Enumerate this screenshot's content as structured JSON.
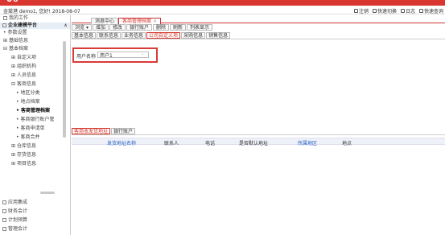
{
  "user": {
    "welcome": "金棠港 demo1, 您好! 2018-08-07"
  },
  "header_links": [
    {
      "label": "注销",
      "icon": "logout-icon"
    },
    {
      "label": "快速切换",
      "icon": "switch-icon"
    },
    {
      "label": "日志",
      "icon": "log-icon"
    },
    {
      "label": "快速查询",
      "icon": "quick-search-icon"
    }
  ],
  "sidebar": {
    "my_work": "我的工作",
    "section": "企业建模平台",
    "items": [
      {
        "label": "参数设置",
        "prefix": "•"
      },
      {
        "label": "基础信息",
        "prefix": "⊞"
      },
      {
        "label": "基本档案",
        "prefix": "⊟"
      },
      {
        "label": "自定义项",
        "prefix": "⊞"
      },
      {
        "label": "组织机构",
        "prefix": "⊞"
      },
      {
        "label": "人员信息",
        "prefix": "⊞"
      },
      {
        "label": "客商信息",
        "prefix": "⊟"
      },
      {
        "label": "地区分类",
        "prefix": "•"
      },
      {
        "label": "地点档案",
        "prefix": "•"
      },
      {
        "label": "客商管理档案",
        "prefix": "•"
      },
      {
        "label": "客商银行账户管",
        "prefix": "•"
      },
      {
        "label": "客商申请单",
        "prefix": "•"
      },
      {
        "label": "客商合并",
        "prefix": "•"
      },
      {
        "label": "仓库信息",
        "prefix": "⊞"
      },
      {
        "label": "存货信息",
        "prefix": "⊞"
      },
      {
        "label": "项目信息",
        "prefix": "⊞"
      }
    ],
    "bottom": [
      {
        "label": "应用集成"
      },
      {
        "label": "财务会计"
      },
      {
        "label": "计划预算"
      },
      {
        "label": "管理会计"
      }
    ]
  },
  "tabs": [
    {
      "label": "消息中心"
    },
    {
      "label": "客商管理档案"
    }
  ],
  "toolbar": [
    "浏览",
    "增加",
    "修改",
    "银行账户",
    "删除",
    "刷新",
    "列表显示"
  ],
  "subtabs": [
    "基本信息",
    "联系信息",
    "业务信息",
    "公司自定义项",
    "采购信息",
    "销售信息"
  ],
  "form": {
    "label": "用户名称",
    "value": "用户1"
  },
  "lower_tabs": [
    "客商收发货地址",
    "银行账户"
  ],
  "grid_headers": [
    {
      "label": "发货地址名称",
      "blue": true
    },
    {
      "label": "联系人",
      "blue": false
    },
    {
      "label": "电话",
      "blue": false
    },
    {
      "label": "是否默认地址",
      "blue": false
    },
    {
      "label": "所属地区",
      "blue": true
    },
    {
      "label": "地点",
      "blue": false
    }
  ],
  "colors": {
    "brand_red": "#d9362f",
    "accent_blue": "#2a62c8"
  }
}
